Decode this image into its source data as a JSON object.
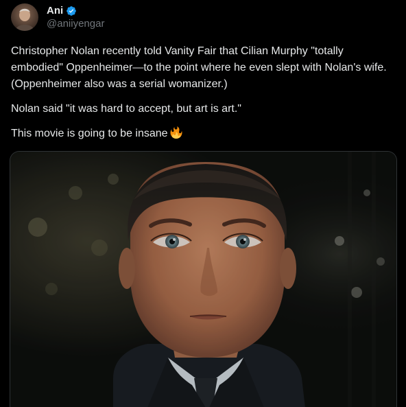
{
  "author": {
    "display_name": "Ani",
    "handle": "@aniiyengar",
    "avatar_icon": "profile-photo-avatar",
    "verified_icon": "verified-badge-icon",
    "verified_color": "#1d9bf0"
  },
  "tweet": {
    "paragraphs": [
      "Christopher Nolan recently told Vanity Fair that Cilian Murphy \"totally embodied\" Oppenheimer—to the point where he even slept with Nolan's wife. (Oppenheimer also was a serial womanizer.)",
      "Nolan said \"it was hard to accept, but art is art.\"",
      "This movie is going to be insane"
    ],
    "emoji_icon": "fire-emoji-icon"
  },
  "media": {
    "kind": "photo",
    "subject_icon": "close-up-portrait-photo"
  },
  "colors": {
    "background": "#000000",
    "text": "#e7e9ea",
    "secondary_text": "#71767b",
    "border": "#2f3336"
  }
}
